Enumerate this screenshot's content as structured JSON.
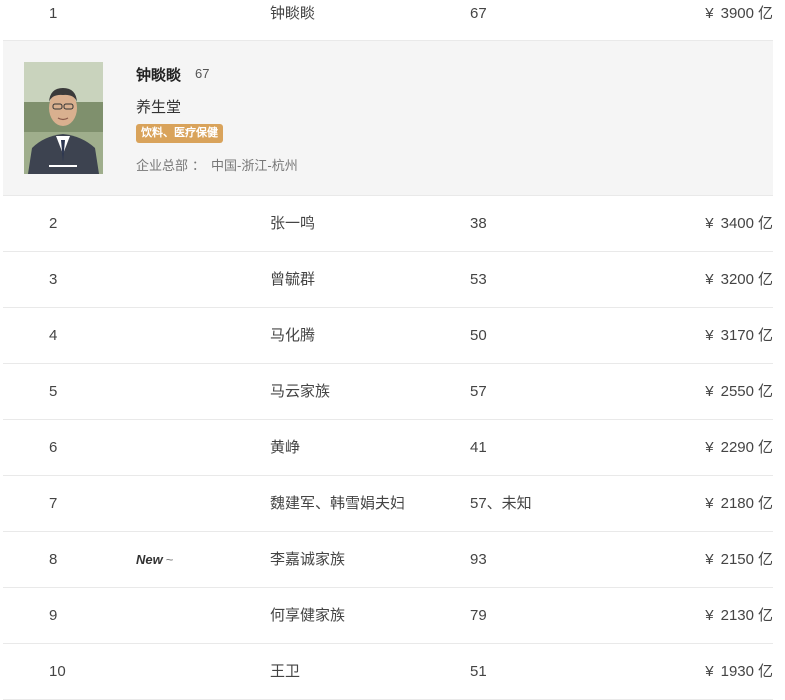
{
  "featured": {
    "name": "钟睒睒",
    "age": "67",
    "company": "养生堂",
    "industry": "饮料、医疗保健",
    "hq_label": "企业总部",
    "hq_sep": "：",
    "hq_value": "中国-浙江-杭州",
    "photo_icon": "person-portrait"
  },
  "currency_symbol": "¥",
  "unit": "亿",
  "rows": [
    {
      "rank": "1",
      "tag": "",
      "name": "钟睒睒",
      "age": "67",
      "wealth": "3900"
    },
    {
      "rank": "2",
      "tag": "",
      "name": "张一鸣",
      "age": "38",
      "wealth": "3400"
    },
    {
      "rank": "3",
      "tag": "",
      "name": "曾毓群",
      "age": "53",
      "wealth": "3200"
    },
    {
      "rank": "4",
      "tag": "",
      "name": "马化腾",
      "age": "50",
      "wealth": "3170"
    },
    {
      "rank": "5",
      "tag": "",
      "name": "马云家族",
      "age": "57",
      "wealth": "2550"
    },
    {
      "rank": "6",
      "tag": "",
      "name": "黄峥",
      "age": "41",
      "wealth": "2290"
    },
    {
      "rank": "7",
      "tag": "",
      "name": "魏建军、韩雪娟夫妇",
      "age": "57、未知",
      "wealth": "2180"
    },
    {
      "rank": "8",
      "tag": "New",
      "tag_mark": "~",
      "name": "李嘉诚家族",
      "age": "93",
      "wealth": "2150"
    },
    {
      "rank": "9",
      "tag": "",
      "name": "何享健家族",
      "age": "79",
      "wealth": "2130"
    },
    {
      "rank": "10",
      "tag": "",
      "name": "王卫",
      "age": "51",
      "wealth": "1930"
    }
  ]
}
